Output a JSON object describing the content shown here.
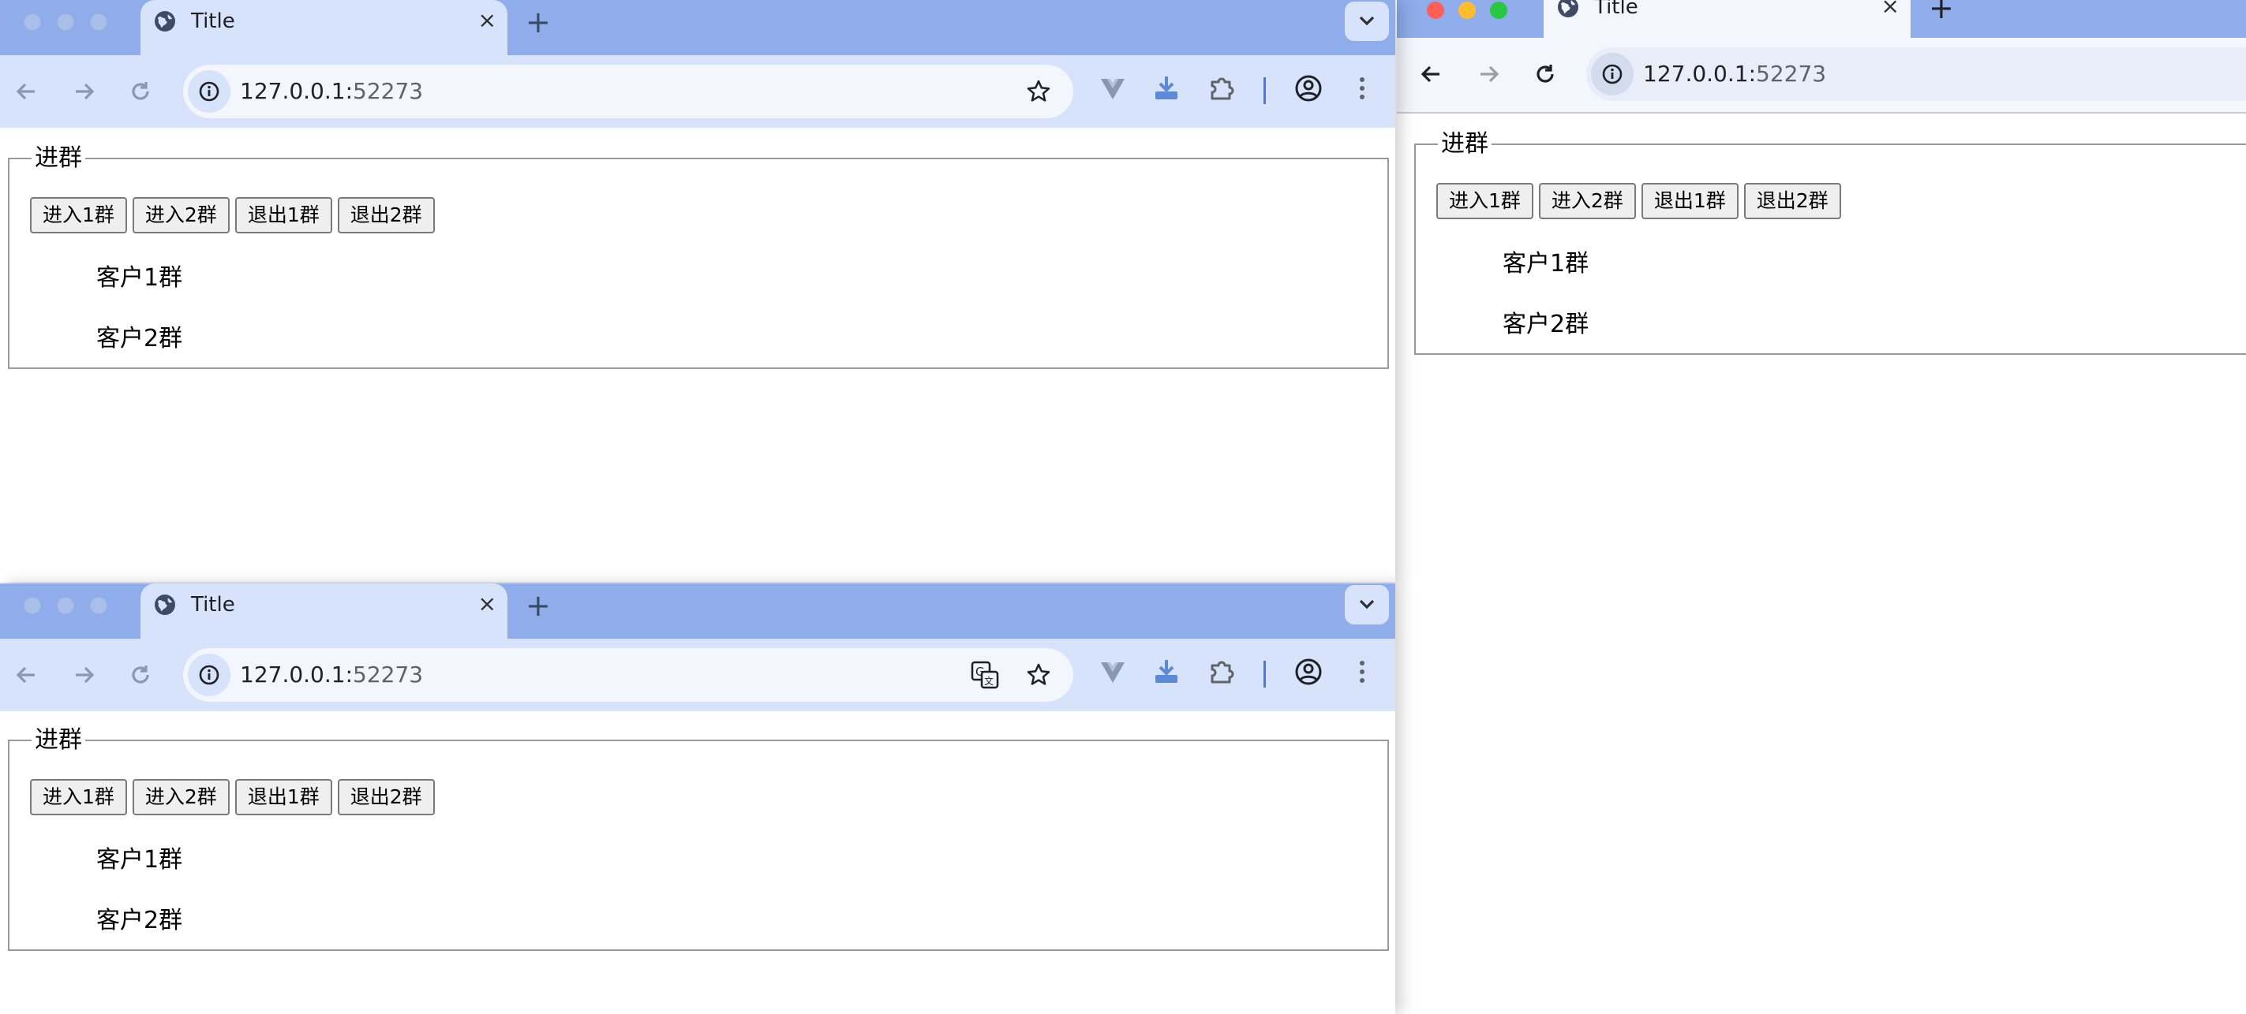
{
  "colors": {
    "tabstrip": "#8eadea",
    "toolbar": "#d7e2fb",
    "omnibox": "#f3f6fd",
    "page": "#ffffff"
  },
  "windows": [
    {
      "id": "top-left",
      "active": false,
      "tab": {
        "title": "Title",
        "close_label": "×",
        "new_tab_label": "+"
      },
      "url": {
        "host": "127.0.0.1:",
        "port": "52273"
      },
      "show_translate_icon": false,
      "group": {
        "legend": "进群",
        "buttons": [
          "进入1群",
          "进入2群",
          "退出1群",
          "退出2群"
        ],
        "customers": [
          "客户1群",
          "客户2群"
        ]
      }
    },
    {
      "id": "bottom-left",
      "active": false,
      "tab": {
        "title": "Title",
        "close_label": "×",
        "new_tab_label": "+"
      },
      "url": {
        "host": "127.0.0.1:",
        "port": "52273"
      },
      "show_translate_icon": true,
      "group": {
        "legend": "进群",
        "buttons": [
          "进入1群",
          "进入2群",
          "退出1群",
          "退出2群"
        ],
        "customers": [
          "客户1群",
          "客户2群"
        ]
      }
    },
    {
      "id": "right",
      "active": true,
      "tab": {
        "title": "Title",
        "close_label": "×",
        "new_tab_label": "+"
      },
      "url": {
        "host": "127.0.0.1:",
        "port": "52273"
      },
      "show_translate_icon": false,
      "group": {
        "legend": "进群",
        "buttons": [
          "进入1群",
          "进入2群",
          "退出1群",
          "退出2群"
        ],
        "customers": [
          "客户1群",
          "客户2群"
        ]
      }
    }
  ],
  "icons": {
    "globe": "globe-icon",
    "back": "arrow-left-icon",
    "forward": "arrow-right-icon",
    "reload": "reload-icon",
    "info": "info-icon",
    "star": "star-icon",
    "translate": "translate-icon",
    "vue_devtools": "vue-devtools-icon",
    "download_ext": "download-extension-icon",
    "extensions": "puzzle-icon",
    "profile": "profile-icon",
    "menu": "kebab-menu-icon",
    "tab_search": "chevron-down-icon"
  }
}
